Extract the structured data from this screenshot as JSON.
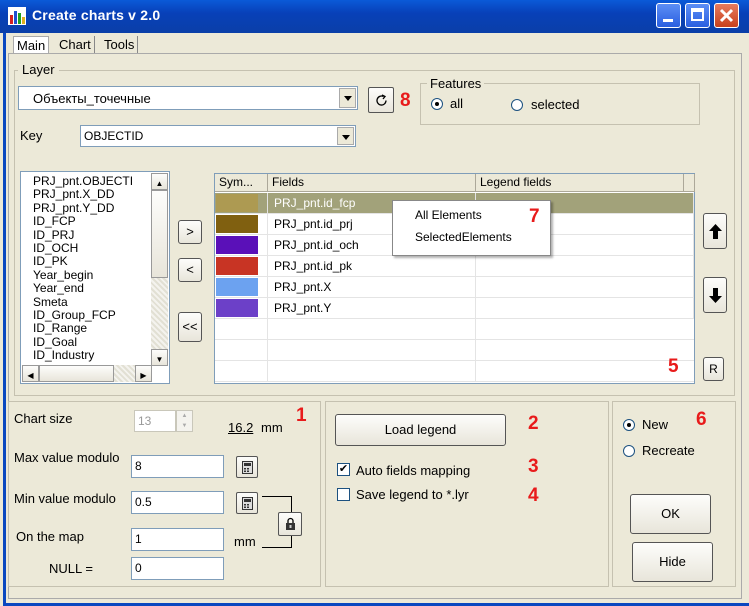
{
  "window": {
    "title": "Create charts v 2.0"
  },
  "tabs": [
    "Main",
    "Chart",
    "Tools"
  ],
  "layer": {
    "group_label": "Layer",
    "layer_value": "Объекты_точечные",
    "key_label": "Key",
    "key_value": "OBJECTID",
    "badge_8": "8"
  },
  "features": {
    "label": "Features",
    "all_label": "all",
    "selected_label": "selected"
  },
  "fields_list": [
    "PRJ_pnt.OBJECTI",
    "PRJ_pnt.X_DD",
    "PRJ_pnt.Y_DD",
    "ID_FCP",
    "ID_PRJ",
    "ID_OCH",
    "ID_PK",
    "Year_begin",
    "Year_end",
    "Smeta",
    "ID_Group_FCP",
    "ID_Range",
    "ID_Goal",
    "ID_Industry"
  ],
  "move_buttons": {
    "add": ">",
    "remove": "<",
    "remove_all": "<<"
  },
  "grid": {
    "headers": [
      "Sym...",
      "Fields",
      "Legend fields"
    ],
    "rows": [
      {
        "color": "#ad9a52",
        "field": "PRJ_pnt.id_fcp",
        "legend": ""
      },
      {
        "color": "#806010",
        "field": "PRJ_pnt.id_prj",
        "legend": ""
      },
      {
        "color": "#5a10b8",
        "field": "PRJ_pnt.id_och",
        "legend": ""
      },
      {
        "color": "#c83424",
        "field": "PRJ_pnt.id_pk",
        "legend": ""
      },
      {
        "color": "#6ca2f0",
        "field": "PRJ_pnt.X",
        "legend": ""
      },
      {
        "color": "#6c40c8",
        "field": "PRJ_pnt.Y",
        "legend": ""
      }
    ],
    "selected_row_color": "#a2a27a",
    "badge_5": "5",
    "r_button": "R"
  },
  "context_menu": {
    "items": [
      "All Elements",
      "SelectedElements"
    ],
    "badge_7": "7"
  },
  "size_panel": {
    "chart_size_label": "Chart size",
    "chart_size_value": "13",
    "size_mm_value": "16.2",
    "mm_unit": "mm",
    "badge_1": "1",
    "max_label": "Max value modulo",
    "max_value": "8",
    "min_label": "Min value modulo",
    "min_value": "0.5",
    "on_map_label": "On the map",
    "on_map_value": "1",
    "on_map_unit": "mm",
    "null_label": "NULL =",
    "null_value": "0"
  },
  "legend_panel": {
    "load_legend": "Load legend",
    "badge_2": "2",
    "auto_mapping": "Auto fields mapping",
    "badge_3": "3",
    "save_legend": "Save legend to *.lyr",
    "badge_4": "4"
  },
  "mode_panel": {
    "new_label": "New",
    "recreate_label": "Recreate",
    "badge_6": "6",
    "ok": "OK",
    "hide": "Hide"
  }
}
